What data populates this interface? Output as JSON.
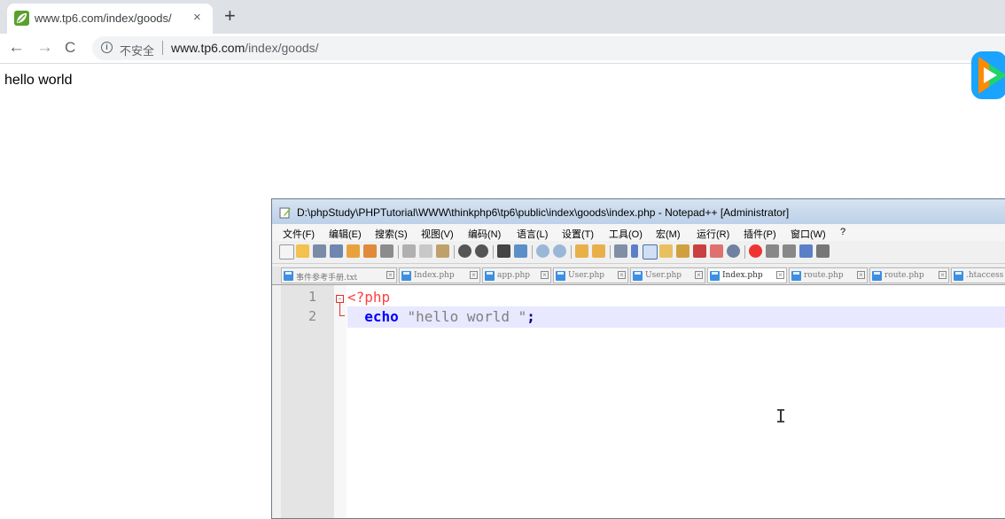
{
  "browser": {
    "tab_title": "www.tp6.com/index/goods/",
    "tab_close": "×",
    "new_tab": "+",
    "nav": {
      "back": "←",
      "forward": "→",
      "reload": "C"
    },
    "security_label": "不安全",
    "url_host": "www.tp6.com",
    "url_path": "/index/goods/"
  },
  "page": {
    "text": "hello world"
  },
  "notepad": {
    "title": "D:\\phpStudy\\PHPTutorial\\WWW\\thinkphp6\\tp6\\public\\index\\goods\\index.php - Notepad++ [Administrator]",
    "menu": [
      "文件(F)",
      "编辑(E)",
      "搜索(S)",
      "视图(V)",
      "编码(N)",
      "语言(L)",
      "设置(T)",
      "工具(O)",
      "宏(M)",
      "运行(R)",
      "插件(P)",
      "窗口(W)",
      "?"
    ],
    "tabs": [
      "事件参考手册.txt",
      "Index.php",
      "app.php",
      "User.php",
      "User.php",
      "Index.php",
      "route.php",
      "route.php",
      ".htaccess"
    ],
    "lines": [
      {
        "num": "1",
        "php_open": "<?php"
      },
      {
        "num": "2",
        "keyword": "echo",
        "string": "\"hello world \"",
        "semicolon": ";"
      }
    ]
  },
  "colors": {
    "tab_bar": "#dee1e6",
    "php_tag": "#ff4040",
    "keyword": "#0000ff",
    "string": "#808080",
    "line_highlight": "#e8e8ff"
  }
}
